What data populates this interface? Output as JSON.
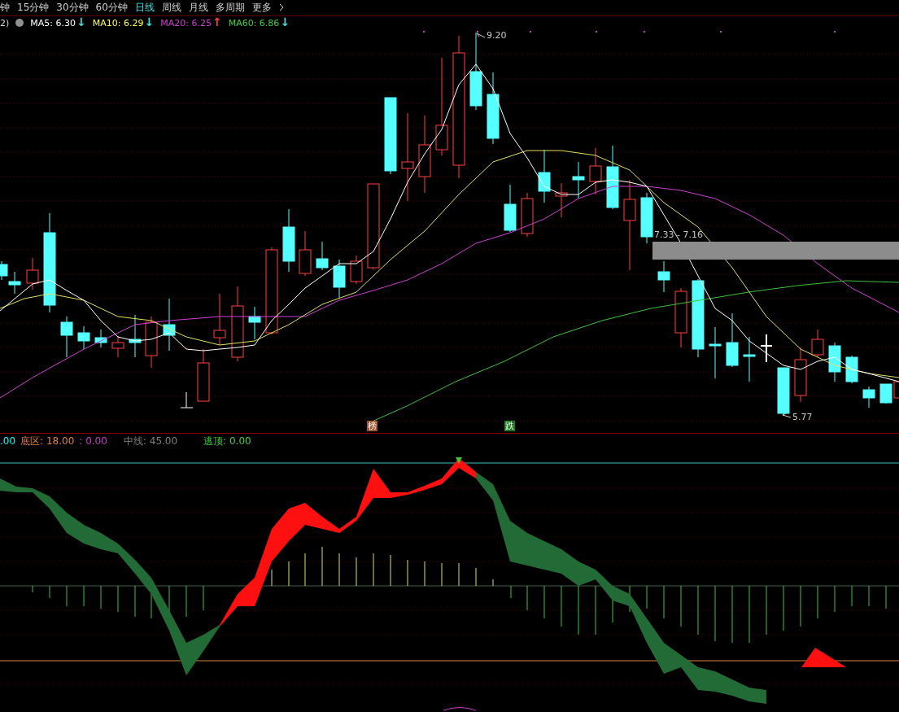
{
  "period_tabs": [
    {
      "label": "钟",
      "selected": false
    },
    {
      "label": "15分钟",
      "selected": false
    },
    {
      "label": "30分钟",
      "selected": false
    },
    {
      "label": "60分钟",
      "selected": false
    },
    {
      "label": "日线",
      "selected": true
    },
    {
      "label": "周线",
      "selected": false
    },
    {
      "label": "月线",
      "selected": false
    },
    {
      "label": "多周期",
      "selected": false
    },
    {
      "label": "更多",
      "selected": false
    }
  ],
  "ma_legend": {
    "prefix": "2)",
    "items": [
      {
        "label": "MA5: 6.30",
        "arrow": {
          "text": "↓",
          "color": "#40e0e0"
        },
        "color": "#ffffff"
      },
      {
        "label": "MA10: 6.29",
        "arrow": {
          "text": "↓",
          "color": "#40e0e0"
        },
        "color": "#ffff55"
      },
      {
        "label": "MA20: 6.25",
        "arrow": {
          "text": "↑",
          "color": "#ff4040"
        },
        "color": "#d040d0"
      },
      {
        "label": "MA60: 6.86",
        "arrow": {
          "text": "↓",
          "color": "#40e0e0"
        },
        "color": "#40d040"
      }
    ]
  },
  "price_labels": {
    "high": "9.20",
    "range": "7.33 - 7.16",
    "low": "5.77"
  },
  "signal_marks": [
    {
      "label": "榜",
      "color": "#a0522d"
    },
    {
      "label": "跌",
      "color": "#1e7a1e"
    }
  ],
  "indicator_legend": [
    {
      "label": ".00",
      "color": "#00ffff"
    },
    {
      "label": "底区: 18.00",
      "color": "#e08040"
    },
    {
      "label": ": 0.00",
      "color": "#c040c0"
    },
    {
      "label": "中线: 45.00",
      "color": "#808080"
    },
    {
      "label": "逃顶: 0.00",
      "color": "#40d040"
    }
  ]
}
